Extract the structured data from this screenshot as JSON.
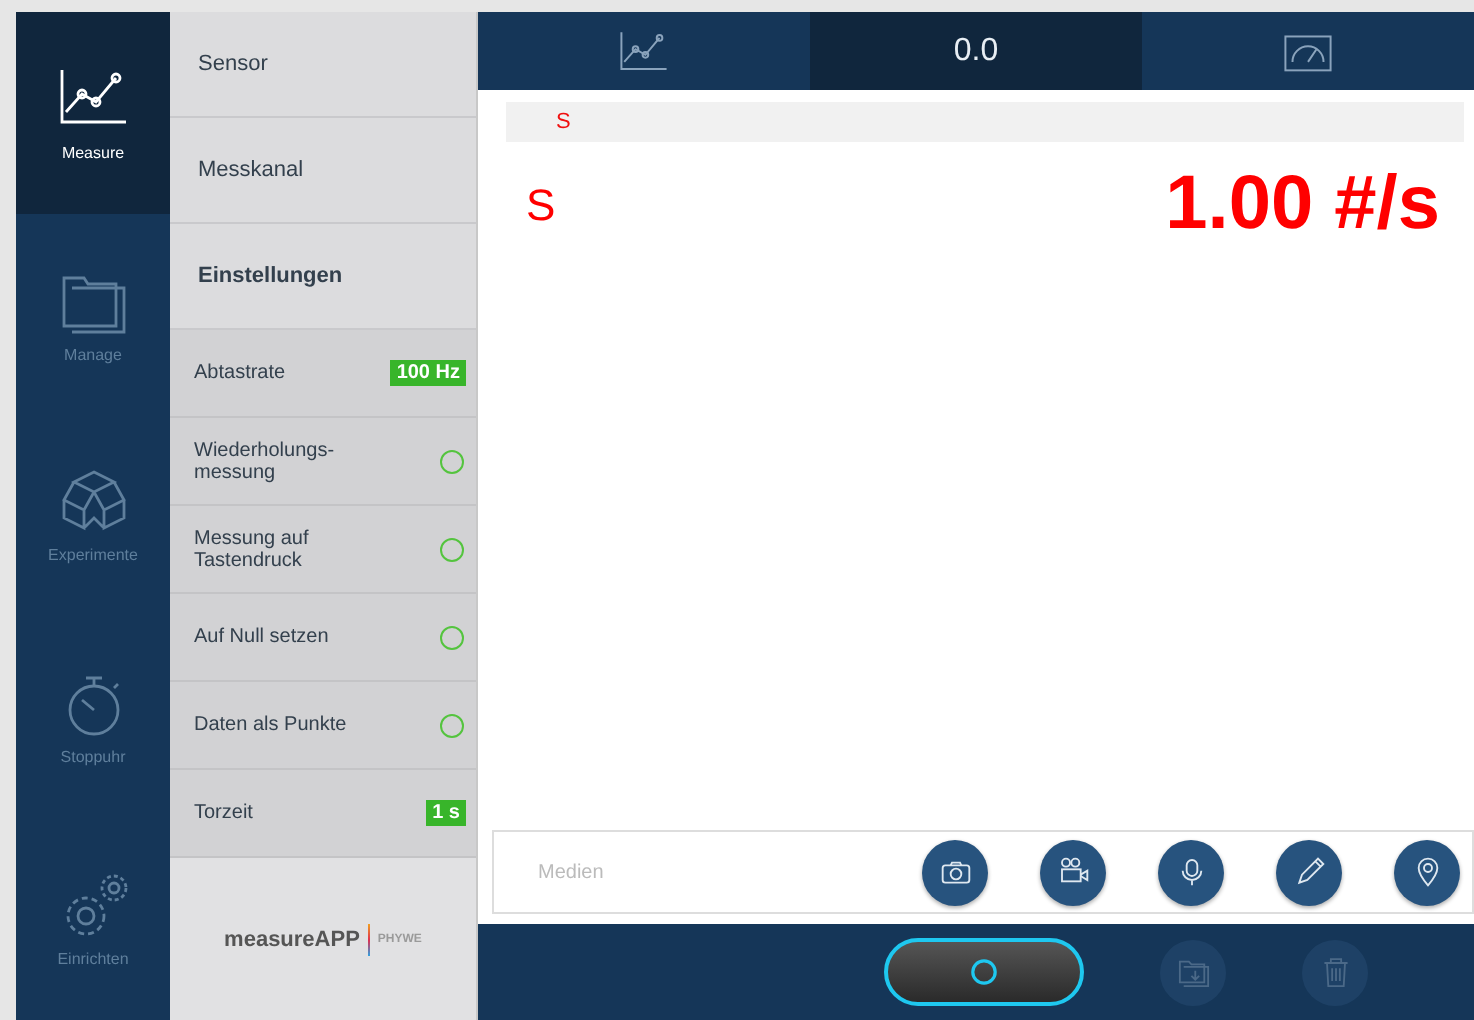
{
  "nav": [
    {
      "label": "Measure",
      "selected": true
    },
    {
      "label": "Manage",
      "selected": false
    },
    {
      "label": "Experimente",
      "selected": false
    },
    {
      "label": "Stoppuhr",
      "selected": false
    },
    {
      "label": "Einrichten",
      "selected": false
    }
  ],
  "menu": [
    {
      "label": "Sensor",
      "selected": false
    },
    {
      "label": "Messkanal",
      "selected": false
    },
    {
      "label": "Einstellungen",
      "selected": true
    }
  ],
  "settings": [
    {
      "kind": "badge",
      "label": "Abtastrate",
      "value": "100 Hz"
    },
    {
      "kind": "toggle",
      "label": "Wiederholungs-\nmessung",
      "on": false
    },
    {
      "kind": "toggle",
      "label": "Messung auf\nTastendruck",
      "on": false
    },
    {
      "kind": "toggle",
      "label": "Auf Null setzen",
      "on": false
    },
    {
      "kind": "toggle",
      "label": "Daten als Punkte",
      "on": false
    },
    {
      "kind": "badge",
      "label": "Torzeit",
      "value": "1 s"
    }
  ],
  "logo": {
    "name": "measureAPP",
    "brand": "PHYWE"
  },
  "tabs": [
    {
      "kind": "chart",
      "selected": false
    },
    {
      "kind": "text",
      "label": "0.0",
      "selected": true
    },
    {
      "kind": "gauge",
      "selected": false
    }
  ],
  "channel": {
    "header": "S",
    "symbol": "S",
    "value": "1.00 #/s"
  },
  "media": {
    "label": "Medien",
    "buttons": [
      {
        "kind": "camera"
      },
      {
        "kind": "video"
      },
      {
        "kind": "microphone"
      },
      {
        "kind": "pencil"
      },
      {
        "kind": "pin"
      }
    ]
  },
  "actions": [
    {
      "kind": "record",
      "disabled": false
    },
    {
      "kind": "export",
      "disabled": true
    },
    {
      "kind": "delete",
      "disabled": true
    }
  ]
}
